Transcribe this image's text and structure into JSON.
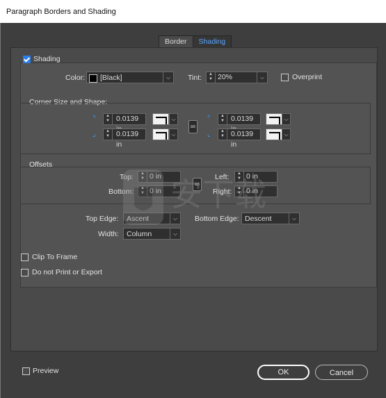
{
  "window": {
    "title": "Paragraph Borders and Shading"
  },
  "tabs": [
    {
      "label": "Border",
      "active": false
    },
    {
      "label": "Shading",
      "active": true
    }
  ],
  "shading": {
    "checkbox_label": "Shading",
    "checked": true,
    "color_label": "Color:",
    "color_value": "[Black]",
    "tint_label": "Tint:",
    "tint_value": "20%",
    "overprint_label": "Overprint",
    "overprint_checked": false
  },
  "corner": {
    "group_label": "Corner Size and Shape:",
    "top_left": "0.0139 in",
    "bottom_left": "0.0139 in",
    "top_right": "0.0139 in",
    "bottom_right": "0.0139 in",
    "link_icon": "chain-link-icon"
  },
  "offsets": {
    "group_label": "Offsets",
    "top_label": "Top:",
    "top_value": "0 in",
    "bottom_label": "Bottom:",
    "bottom_value": "0 in",
    "left_label": "Left:",
    "left_value": "0 in",
    "right_label": "Right:",
    "right_value": "0 in"
  },
  "edges": {
    "top_edge_label": "Top Edge:",
    "top_edge_value": "Ascent",
    "bottom_edge_label": "Bottom Edge:",
    "bottom_edge_value": "Descent",
    "width_label": "Width:",
    "width_value": "Column"
  },
  "options": {
    "clip_to_frame": "Clip To Frame",
    "do_not_print": "Do not Print or Export"
  },
  "footer": {
    "preview_label": "Preview",
    "ok_label": "OK",
    "cancel_label": "Cancel"
  },
  "colors": {
    "accent": "#2b7de9",
    "tab_active_text": "#5aa6ff",
    "background": "#3e3e3e"
  }
}
